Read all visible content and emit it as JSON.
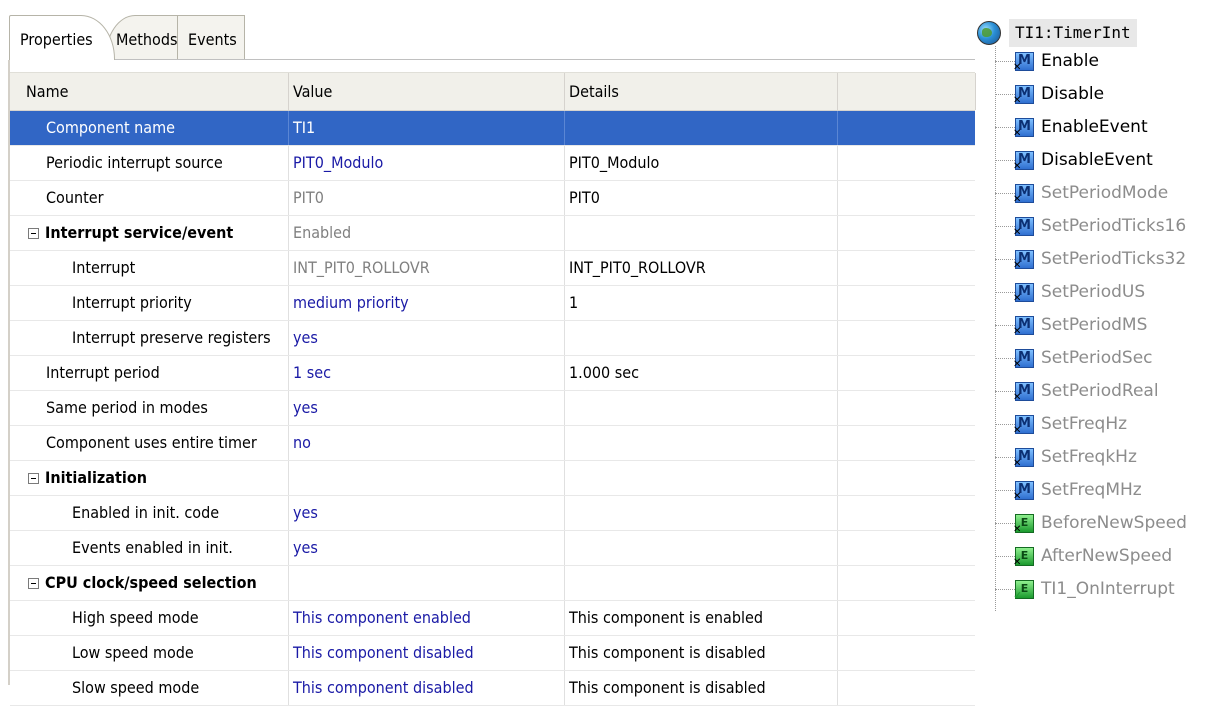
{
  "tabs": {
    "properties": "Properties",
    "methods": "Methods",
    "events": "Events"
  },
  "grid": {
    "headers": {
      "name": "Name",
      "value": "Value",
      "details": "Details"
    },
    "rows": [
      {
        "name": "Component name",
        "value": "TI1",
        "details": ""
      },
      {
        "name": "Periodic interrupt source",
        "value": "PIT0_Modulo",
        "details": "PIT0_Modulo"
      },
      {
        "name": "Counter",
        "value": "PIT0",
        "details": "PIT0"
      },
      {
        "name": "Interrupt service/event",
        "value": "Enabled",
        "details": ""
      },
      {
        "name": "Interrupt",
        "value": "INT_PIT0_ROLLOVR",
        "details": "INT_PIT0_ROLLOVR"
      },
      {
        "name": "Interrupt priority",
        "value": "medium priority",
        "details": "1"
      },
      {
        "name": "Interrupt preserve registers",
        "value": "yes",
        "details": ""
      },
      {
        "name": "Interrupt period",
        "value": "1 sec",
        "details": "1.000 sec"
      },
      {
        "name": "Same period in modes",
        "value": "yes",
        "details": ""
      },
      {
        "name": "Component uses entire timer",
        "value": "no",
        "details": ""
      },
      {
        "name": "Initialization",
        "value": "",
        "details": ""
      },
      {
        "name": "Enabled in init. code",
        "value": "yes",
        "details": ""
      },
      {
        "name": "Events enabled in init.",
        "value": "yes",
        "details": ""
      },
      {
        "name": "CPU clock/speed selection",
        "value": "",
        "details": ""
      },
      {
        "name": "High speed mode",
        "value": "This component enabled",
        "details": "This component is enabled"
      },
      {
        "name": "Low speed mode",
        "value": "This component disabled",
        "details": "This component is disabled"
      },
      {
        "name": "Slow speed mode",
        "value": "This component disabled",
        "details": "This component is disabled"
      }
    ]
  },
  "tree": {
    "root": "TI1:TimerInt",
    "root_icon": "globe-icon",
    "items": [
      {
        "label": "Enable",
        "icon": "method-icon"
      },
      {
        "label": "Disable",
        "icon": "method-icon"
      },
      {
        "label": "EnableEvent",
        "icon": "method-icon"
      },
      {
        "label": "DisableEvent",
        "icon": "method-icon"
      },
      {
        "label": "SetPeriodMode",
        "icon": "method-icon"
      },
      {
        "label": "SetPeriodTicks16",
        "icon": "method-icon"
      },
      {
        "label": "SetPeriodTicks32",
        "icon": "method-icon"
      },
      {
        "label": "SetPeriodUS",
        "icon": "method-icon"
      },
      {
        "label": "SetPeriodMS",
        "icon": "method-icon"
      },
      {
        "label": "SetPeriodSec",
        "icon": "method-icon"
      },
      {
        "label": "SetPeriodReal",
        "icon": "method-icon"
      },
      {
        "label": "SetFreqHz",
        "icon": "method-icon"
      },
      {
        "label": "SetFreqkHz",
        "icon": "method-icon"
      },
      {
        "label": "SetFreqMHz",
        "icon": "method-icon"
      },
      {
        "label": "BeforeNewSpeed",
        "icon": "event-icon"
      },
      {
        "label": "AfterNewSpeed",
        "icon": "event-icon"
      },
      {
        "label": "TI1_OnInterrupt",
        "icon": "event-icon"
      }
    ]
  },
  "colors": {
    "selection": "#3166c5",
    "value_blue": "#1a1aa6",
    "disabled_gray": "#8c8c8c"
  }
}
